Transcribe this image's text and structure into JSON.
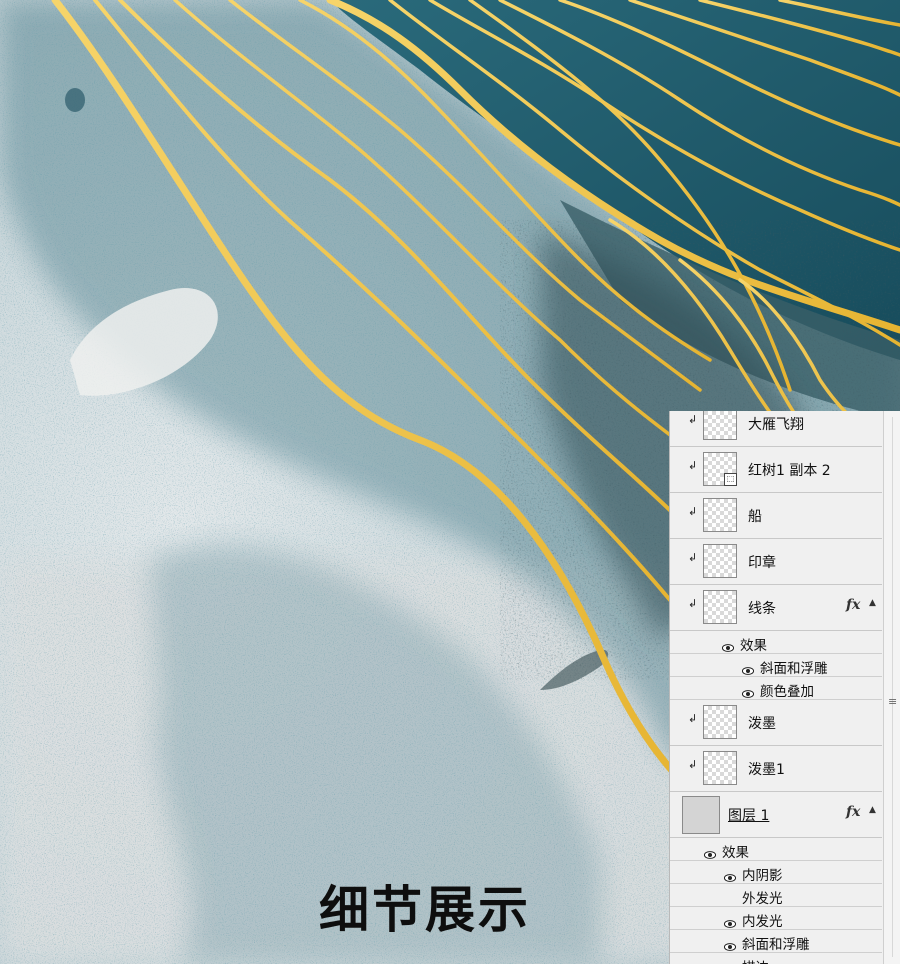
{
  "caption": "细节展示",
  "colors": {
    "teal": "#1f5868",
    "gold_line": "#f0c24a",
    "mist": "#d6dadb",
    "panel_bg": "#f0f0f0"
  },
  "layers_panel": {
    "layers": [
      {
        "name": "大雁飞翔",
        "clipped": true,
        "fx": false,
        "linked": false
      },
      {
        "name": "红树1 副本 2",
        "clipped": true,
        "fx": false,
        "linked": true
      },
      {
        "name": "船",
        "clipped": true,
        "fx": false,
        "linked": false
      },
      {
        "name": "印章",
        "clipped": true,
        "fx": false,
        "linked": false
      },
      {
        "name": "线条",
        "clipped": true,
        "fx": true,
        "linked": false,
        "effects_title": "效果",
        "effects": [
          "斜面和浮雕",
          "颜色叠加"
        ]
      },
      {
        "name": "泼墨",
        "clipped": true,
        "fx": false,
        "linked": false
      },
      {
        "name": "泼墨1",
        "clipped": true,
        "fx": false,
        "linked": false
      },
      {
        "name": "图层 1",
        "clipped": false,
        "fx": true,
        "linked": false,
        "effects_title": "效果",
        "effects": [
          {
            "label": "内阴影",
            "visible": true
          },
          {
            "label": "外发光",
            "visible": false
          },
          {
            "label": "内发光",
            "visible": true
          },
          {
            "label": "斜面和浮雕",
            "visible": true
          },
          {
            "label": "描边",
            "visible": true
          }
        ]
      }
    ],
    "fx_label": "fx",
    "clip_glyph": "↲",
    "eye": "eye-icon"
  }
}
